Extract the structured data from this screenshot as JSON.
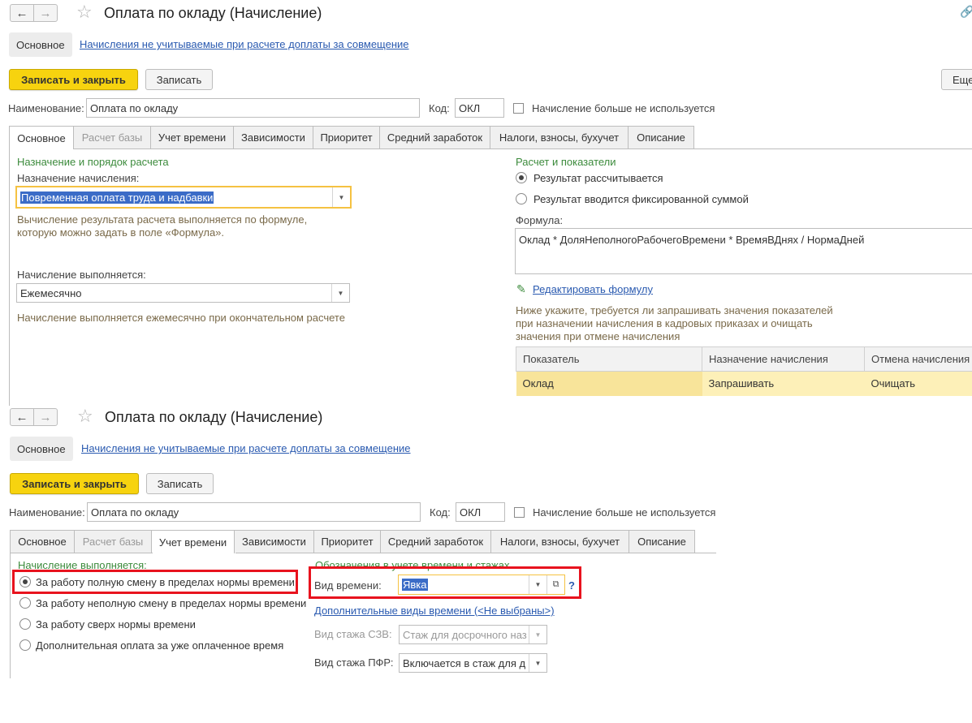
{
  "top": {
    "title": "Оплата по окладу (Начисление)",
    "subnav": {
      "main": "Основное",
      "link": "Начисления не учитываемые при расчете доплаты за совмещение"
    },
    "toolbar": {
      "save_close": "Записать и закрыть",
      "save": "Записать",
      "more": "Еще"
    },
    "name_label": "Наименование:",
    "name_value": "Оплата по окладу",
    "code_label": "Код:",
    "code_value": "ОКЛ",
    "unused_label": "Начисление больше не используется",
    "tabs": [
      "Основное",
      "Расчет базы",
      "Учет времени",
      "Зависимости",
      "Приоритет",
      "Средний заработок",
      "Налоги, взносы, бухучет",
      "Описание"
    ],
    "left": {
      "section": "Назначение и порядок расчета",
      "purpose_label": "Назначение начисления:",
      "purpose_value": "Повременная оплата труда и надбавки",
      "hint1": "Вычисление результата расчета выполняется по формуле,",
      "hint2": "которую можно задать в поле «Формула».",
      "period_label": "Начисление выполняется:",
      "period_value": "Ежемесячно",
      "period_hint": "Начисление выполняется ежемесячно при окончательном расчете"
    },
    "right": {
      "section": "Расчет и показатели",
      "radio1": "Результат рассчитывается",
      "radio2": "Результат вводится фиксированной суммой",
      "formula_label": "Формула:",
      "formula_value": "Оклад * ДоляНеполногоРабочегоВремени * ВремяВДнях / НормаДней",
      "edit_formula": "Редактировать формулу",
      "note1": "Ниже укажите, требуется ли запрашивать значения показателей",
      "note2": "при назначении начисления в кадровых приказах и очищать",
      "note3": "значения при отмене начисления",
      "table": {
        "headers": [
          "Показатель",
          "Назначение начисления",
          "Отмена начисления"
        ],
        "rows": [
          [
            "Оклад",
            "Запрашивать",
            "Очищать"
          ]
        ]
      }
    }
  },
  "bottom": {
    "title": "Оплата по окладу (Начисление)",
    "subnav": {
      "main": "Основное",
      "link": "Начисления не учитываемые при расчете доплаты за совмещение"
    },
    "toolbar": {
      "save_close": "Записать и закрыть",
      "save": "Записать"
    },
    "name_label": "Наименование:",
    "name_value": "Оплата по окладу",
    "code_label": "Код:",
    "code_value": "ОКЛ",
    "unused_label": "Начисление больше не используется",
    "tabs": [
      "Основное",
      "Расчет базы",
      "Учет времени",
      "Зависимости",
      "Приоритет",
      "Средний заработок",
      "Налоги, взносы, бухучет",
      "Описание"
    ],
    "left": {
      "section": "Начисление выполняется:",
      "opt1": "За работу полную смену в пределах нормы времени",
      "opt2": "За работу неполную смену в пределах нормы времени",
      "opt3": "За работу сверх нормы времени",
      "opt4": "Дополнительная оплата за уже оплаченное время"
    },
    "right": {
      "section": "Обозначения в учете времени и стажах",
      "time_label": "Вид времени:",
      "time_value": "Явка",
      "help": "?",
      "extra_link": "Дополнительные виды времени (<Не выбраны>)",
      "szv_label": "Вид стажа СЗВ:",
      "szv_value": "Стаж для досрочного наз",
      "pfr_label": "Вид стажа ПФР:",
      "pfr_value": "Включается в стаж для д"
    }
  }
}
